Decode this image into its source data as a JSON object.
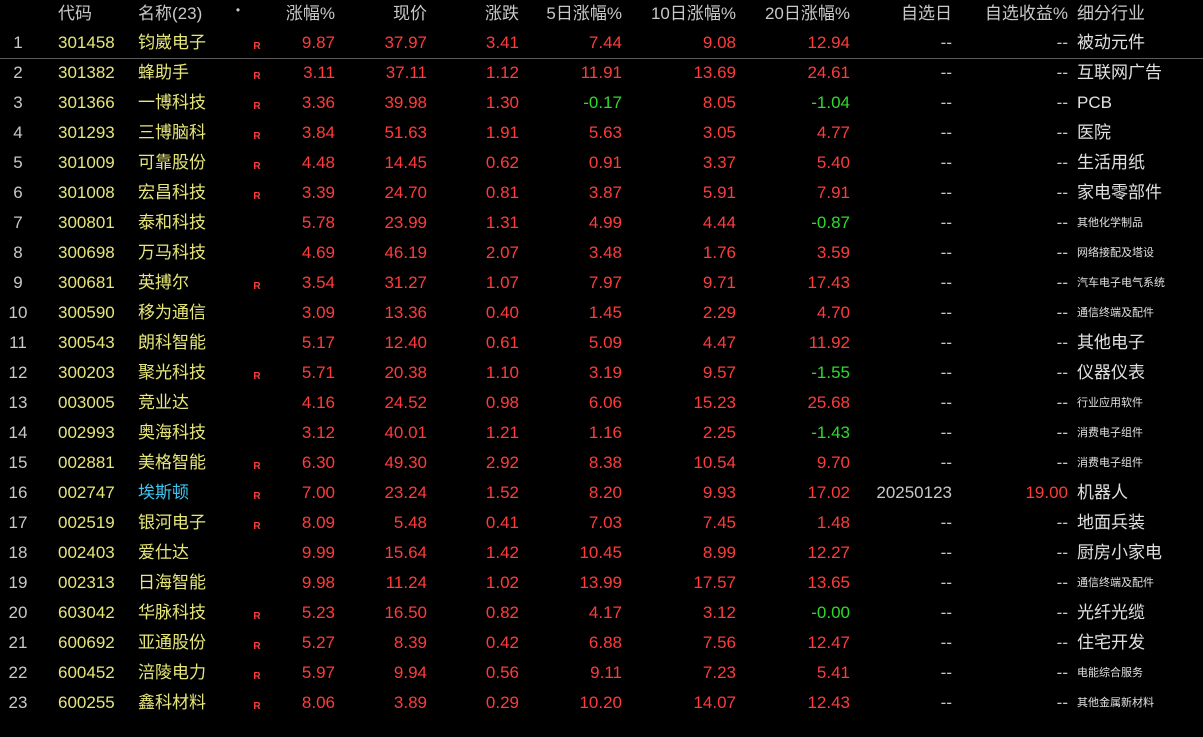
{
  "header": {
    "idx": "",
    "code": "代码",
    "name": "名称(23)",
    "dot": "•",
    "pct": "涨幅%",
    "price": "现价",
    "chg": "涨跌",
    "d5": "5日涨幅%",
    "d10": "10日涨幅%",
    "d20": "20日涨幅%",
    "sel_date": "自选日",
    "sel_ret": "自选收益%",
    "industry": "细分行业"
  },
  "colors": {
    "up": "#ff3b3b",
    "down": "#2bdc2b",
    "code": "#e6e67a",
    "highlight_name": "#3cc6f0"
  },
  "rows": [
    {
      "idx": "1",
      "code": "301458",
      "name": "钧崴电子",
      "flag": "R",
      "pct": "9.87",
      "price": "37.97",
      "chg": "3.41",
      "d5": "7.44",
      "d10": "9.08",
      "d20": "12.94",
      "sel_date": "--",
      "sel_ret": "--",
      "industry": "被动元件",
      "ind_small": false
    },
    {
      "idx": "2",
      "code": "301382",
      "name": "蜂助手",
      "flag": "R",
      "pct": "3.11",
      "price": "37.11",
      "chg": "1.12",
      "d5": "11.91",
      "d10": "13.69",
      "d20": "24.61",
      "sel_date": "--",
      "sel_ret": "--",
      "industry": "互联网广告",
      "ind_small": false
    },
    {
      "idx": "3",
      "code": "301366",
      "name": "一博科技",
      "flag": "R",
      "pct": "3.36",
      "price": "39.98",
      "chg": "1.30",
      "d5": "-0.17",
      "d10": "8.05",
      "d20": "-1.04",
      "sel_date": "--",
      "sel_ret": "--",
      "industry": "PCB",
      "ind_small": false
    },
    {
      "idx": "4",
      "code": "301293",
      "name": "三博脑科",
      "flag": "R",
      "pct": "3.84",
      "price": "51.63",
      "chg": "1.91",
      "d5": "5.63",
      "d10": "3.05",
      "d20": "4.77",
      "sel_date": "--",
      "sel_ret": "--",
      "industry": "医院",
      "ind_small": false
    },
    {
      "idx": "5",
      "code": "301009",
      "name": "可靠股份",
      "flag": "R",
      "pct": "4.48",
      "price": "14.45",
      "chg": "0.62",
      "d5": "0.91",
      "d10": "3.37",
      "d20": "5.40",
      "sel_date": "--",
      "sel_ret": "--",
      "industry": "生活用纸",
      "ind_small": false
    },
    {
      "idx": "6",
      "code": "301008",
      "name": "宏昌科技",
      "flag": "R",
      "pct": "3.39",
      "price": "24.70",
      "chg": "0.81",
      "d5": "3.87",
      "d10": "5.91",
      "d20": "7.91",
      "sel_date": "--",
      "sel_ret": "--",
      "industry": "家电零部件",
      "ind_small": false
    },
    {
      "idx": "7",
      "code": "300801",
      "name": "泰和科技",
      "flag": "",
      "pct": "5.78",
      "price": "23.99",
      "chg": "1.31",
      "d5": "4.99",
      "d10": "4.44",
      "d20": "-0.87",
      "sel_date": "--",
      "sel_ret": "--",
      "industry": "其他化学制品",
      "ind_small": true
    },
    {
      "idx": "8",
      "code": "300698",
      "name": "万马科技",
      "flag": "",
      "pct": "4.69",
      "price": "46.19",
      "chg": "2.07",
      "d5": "3.48",
      "d10": "1.76",
      "d20": "3.59",
      "sel_date": "--",
      "sel_ret": "--",
      "industry": "网络接配及塔设",
      "ind_small": true
    },
    {
      "idx": "9",
      "code": "300681",
      "name": "英搏尔",
      "flag": "R",
      "pct": "3.54",
      "price": "31.27",
      "chg": "1.07",
      "d5": "7.97",
      "d10": "9.71",
      "d20": "17.43",
      "sel_date": "--",
      "sel_ret": "--",
      "industry": "汽车电子电气系统",
      "ind_small": true
    },
    {
      "idx": "10",
      "code": "300590",
      "name": "移为通信",
      "flag": "",
      "pct": "3.09",
      "price": "13.36",
      "chg": "0.40",
      "d5": "1.45",
      "d10": "2.29",
      "d20": "4.70",
      "sel_date": "--",
      "sel_ret": "--",
      "industry": "通信终端及配件",
      "ind_small": true
    },
    {
      "idx": "11",
      "code": "300543",
      "name": "朗科智能",
      "flag": "",
      "pct": "5.17",
      "price": "12.40",
      "chg": "0.61",
      "d5": "5.09",
      "d10": "4.47",
      "d20": "11.92",
      "sel_date": "--",
      "sel_ret": "--",
      "industry": "其他电子",
      "ind_small": false
    },
    {
      "idx": "12",
      "code": "300203",
      "name": "聚光科技",
      "flag": "R",
      "pct": "5.71",
      "price": "20.38",
      "chg": "1.10",
      "d5": "3.19",
      "d10": "9.57",
      "d20": "-1.55",
      "sel_date": "--",
      "sel_ret": "--",
      "industry": "仪器仪表",
      "ind_small": false
    },
    {
      "idx": "13",
      "code": "003005",
      "name": "竞业达",
      "flag": "",
      "pct": "4.16",
      "price": "24.52",
      "chg": "0.98",
      "d5": "6.06",
      "d10": "15.23",
      "d20": "25.68",
      "sel_date": "--",
      "sel_ret": "--",
      "industry": "行业应用软件",
      "ind_small": true
    },
    {
      "idx": "14",
      "code": "002993",
      "name": "奥海科技",
      "flag": "",
      "pct": "3.12",
      "price": "40.01",
      "chg": "1.21",
      "d5": "1.16",
      "d10": "2.25",
      "d20": "-1.43",
      "sel_date": "--",
      "sel_ret": "--",
      "industry": "消费电子组件",
      "ind_small": true
    },
    {
      "idx": "15",
      "code": "002881",
      "name": "美格智能",
      "flag": "R",
      "pct": "6.30",
      "price": "49.30",
      "chg": "2.92",
      "d5": "8.38",
      "d10": "10.54",
      "d20": "9.70",
      "sel_date": "--",
      "sel_ret": "--",
      "industry": "消费电子组件",
      "ind_small": true
    },
    {
      "idx": "16",
      "code": "002747",
      "name": "埃斯顿",
      "flag": "R",
      "pct": "7.00",
      "price": "23.24",
      "chg": "1.52",
      "d5": "8.20",
      "d10": "9.93",
      "d20": "17.02",
      "sel_date": "20250123",
      "sel_ret": "19.00",
      "industry": "机器人",
      "ind_small": false,
      "highlight": true
    },
    {
      "idx": "17",
      "code": "002519",
      "name": "银河电子",
      "flag": "R",
      "pct": "8.09",
      "price": "5.48",
      "chg": "0.41",
      "d5": "7.03",
      "d10": "7.45",
      "d20": "1.48",
      "sel_date": "--",
      "sel_ret": "--",
      "industry": "地面兵装",
      "ind_small": false
    },
    {
      "idx": "18",
      "code": "002403",
      "name": "爱仕达",
      "flag": "",
      "pct": "9.99",
      "price": "15.64",
      "chg": "1.42",
      "d5": "10.45",
      "d10": "8.99",
      "d20": "12.27",
      "sel_date": "--",
      "sel_ret": "--",
      "industry": "厨房小家电",
      "ind_small": false
    },
    {
      "idx": "19",
      "code": "002313",
      "name": "日海智能",
      "flag": "",
      "pct": "9.98",
      "price": "11.24",
      "chg": "1.02",
      "d5": "13.99",
      "d10": "17.57",
      "d20": "13.65",
      "sel_date": "--",
      "sel_ret": "--",
      "industry": "通信终端及配件",
      "ind_small": true
    },
    {
      "idx": "20",
      "code": "603042",
      "name": "华脉科技",
      "flag": "R",
      "pct": "5.23",
      "price": "16.50",
      "chg": "0.82",
      "d5": "4.17",
      "d10": "3.12",
      "d20": "-0.00",
      "sel_date": "--",
      "sel_ret": "--",
      "industry": "光纤光缆",
      "ind_small": false
    },
    {
      "idx": "21",
      "code": "600692",
      "name": "亚通股份",
      "flag": "R",
      "pct": "5.27",
      "price": "8.39",
      "chg": "0.42",
      "d5": "6.88",
      "d10": "7.56",
      "d20": "12.47",
      "sel_date": "--",
      "sel_ret": "--",
      "industry": "住宅开发",
      "ind_small": false
    },
    {
      "idx": "22",
      "code": "600452",
      "name": "涪陵电力",
      "flag": "R",
      "pct": "5.97",
      "price": "9.94",
      "chg": "0.56",
      "d5": "9.11",
      "d10": "7.23",
      "d20": "5.41",
      "sel_date": "--",
      "sel_ret": "--",
      "industry": "电能综合服务",
      "ind_small": true
    },
    {
      "idx": "23",
      "code": "600255",
      "name": "鑫科材料",
      "flag": "R",
      "pct": "8.06",
      "price": "3.89",
      "chg": "0.29",
      "d5": "10.20",
      "d10": "14.07",
      "d20": "12.43",
      "sel_date": "--",
      "sel_ret": "--",
      "industry": "其他金属新材料",
      "ind_small": true
    }
  ]
}
